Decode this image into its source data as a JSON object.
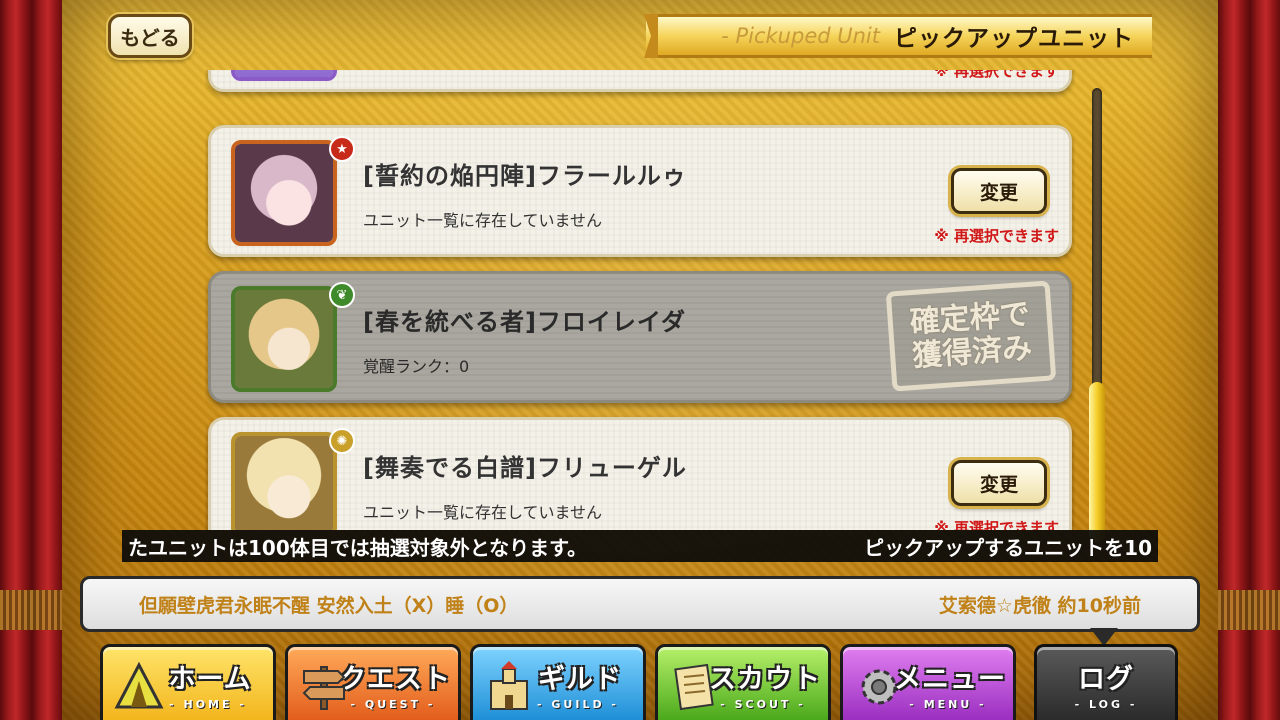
{
  "header": {
    "back_label": "もどる",
    "title_en": "- Pickuped Unit",
    "title_jp": "ピックアップユニット"
  },
  "list": {
    "top_partial_reselect": "※ 再選択できます",
    "cards": [
      {
        "name": "[誓約の焔円陣]フラールルゥ",
        "subtext": "ユニット一覧に存在していません",
        "button": "変更",
        "note": "※ 再選択できます",
        "attribute_icon": "fire-star-icon"
      },
      {
        "name": "[春を統べる者]フロイレイダ",
        "subtext": "覚醒ランク：0",
        "stamp_line1": "確定枠で",
        "stamp_line2": "獲得済み",
        "attribute_icon": "leaf-icon"
      },
      {
        "name": "[舞奏でる白譜]フリューゲル",
        "subtext": "ユニット一覧に存在していません",
        "button": "変更",
        "note": "※ 再選択できます",
        "attribute_icon": "sun-icon"
      }
    ]
  },
  "ticker": {
    "left": "たユニットは100体目では抽選対象外となります。",
    "right": "ピックアップするユニットを10"
  },
  "log": {
    "message": "但願壁虎君永眠不醒 安然入土（X）睡（O）",
    "author_time": "艾索德☆虎徹 約10秒前"
  },
  "nav": {
    "home": {
      "label": "ホーム",
      "sub": "- HOME -"
    },
    "quest": {
      "label": "クエスト",
      "sub": "- QUEST -"
    },
    "guild": {
      "label": "ギルド",
      "sub": "- GUILD -"
    },
    "scout": {
      "label": "スカウト",
      "sub": "- SCOUT -"
    },
    "menu": {
      "label": "メニュー",
      "sub": "- MENU -"
    },
    "log": {
      "label": "ログ",
      "sub": "- LOG -"
    }
  }
}
